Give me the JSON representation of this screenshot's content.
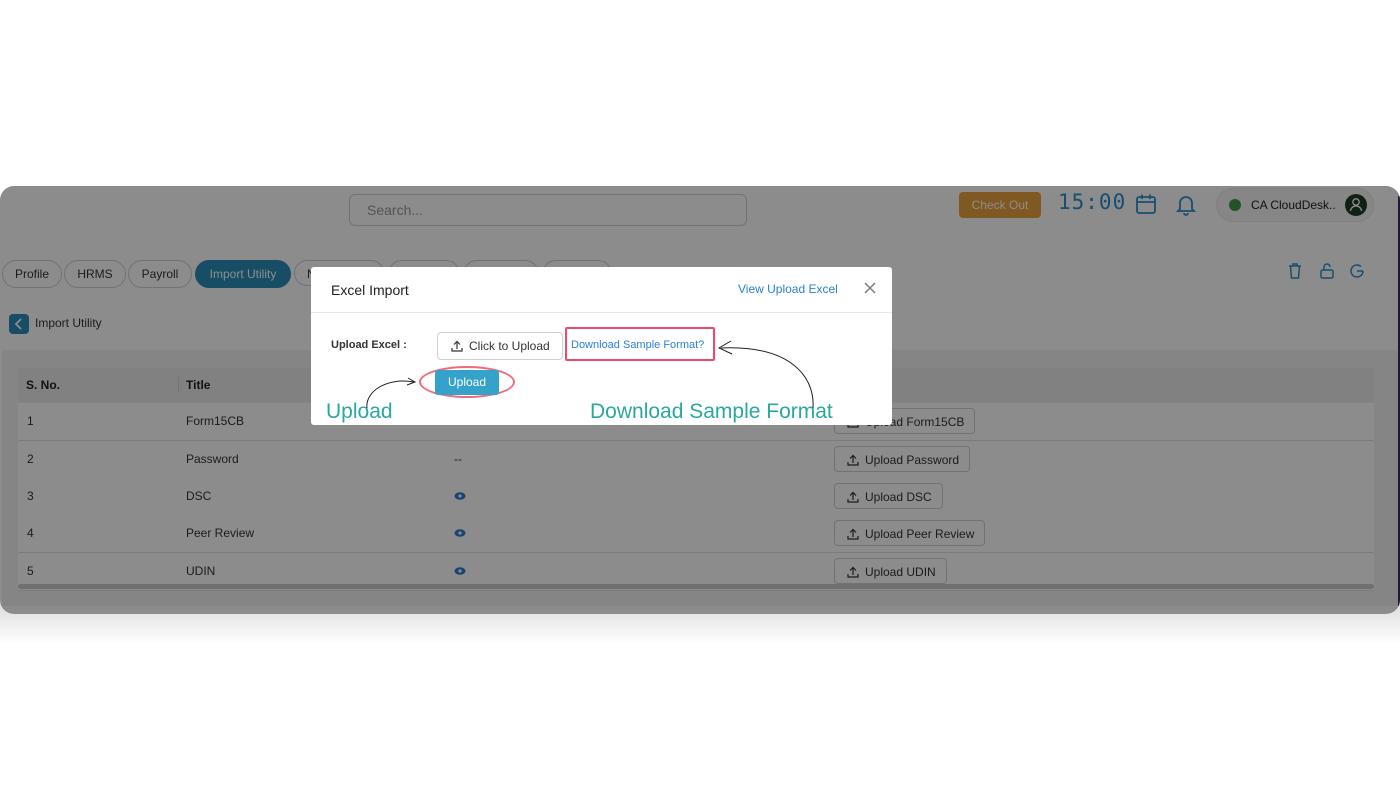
{
  "header": {
    "search_placeholder": "Search...",
    "checkout_label": "Check Out",
    "clock": "15:00",
    "user_name": "CA CloudDesk.."
  },
  "tabs": [
    {
      "label": "Profile",
      "active": false
    },
    {
      "label": "HRMS",
      "active": false
    },
    {
      "label": "Payroll",
      "active": false
    },
    {
      "label": "Import Utility",
      "active": true
    },
    {
      "label": "N",
      "active": false
    },
    {
      "label": "",
      "active": false
    },
    {
      "label": "",
      "active": false
    },
    {
      "label": "",
      "active": false
    }
  ],
  "breadcrumb": {
    "label": "Import Utility"
  },
  "table": {
    "columns": [
      "S. No.",
      "Title",
      "",
      ""
    ],
    "rows": [
      {
        "no": "1",
        "title": "Form15CB",
        "file": "",
        "action": "Upload Form15CB"
      },
      {
        "no": "2",
        "title": "Password",
        "file": "--",
        "action": "Upload Password"
      },
      {
        "no": "3",
        "title": "DSC",
        "file": "eye-icon",
        "action": "Upload DSC"
      },
      {
        "no": "4",
        "title": "Peer Review",
        "file": "eye-icon",
        "action": "Upload Peer Review"
      },
      {
        "no": "5",
        "title": "UDIN",
        "file": "eye-icon",
        "action": "Upload UDIN"
      }
    ]
  },
  "modal": {
    "title": "Excel Import",
    "view_link": "View Upload Excel",
    "upload_label": "Upload Excel :",
    "click_to_upload": "Click to Upload",
    "download_sample": "Download Sample Format?",
    "upload_button": "Upload",
    "annotation_upload": "Upload",
    "annotation_download": "Download Sample Format"
  },
  "colors": {
    "accent": "#2b8fb8",
    "checkout": "#e8a33c",
    "clock": "#2b8fd0",
    "highlight": "#ef4a6a",
    "annotation": "#2aa8a0",
    "link": "#2b7fd4"
  }
}
